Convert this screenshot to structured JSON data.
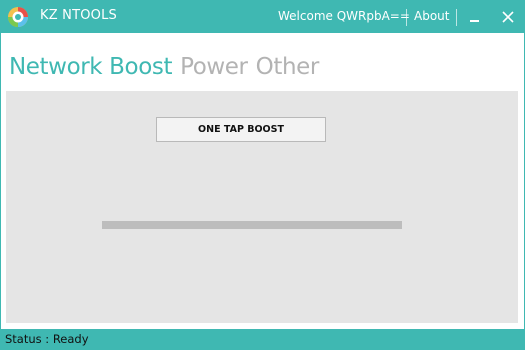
{
  "app": {
    "title": "KZ NTOOLS",
    "welcome": "Welcome QWRpbA==",
    "about_label": "About",
    "accent_color": "#3fb8b2"
  },
  "window_controls": {
    "minimize_icon": "minimize-icon",
    "close_icon": "close-icon"
  },
  "tabs": [
    {
      "label": "Network Boost",
      "active": true
    },
    {
      "label": "Power",
      "active": false
    },
    {
      "label": "Other",
      "active": false
    }
  ],
  "network_boost": {
    "button_label": "ONE TAP BOOST",
    "progress": 0
  },
  "status": {
    "text": "Status : Ready"
  }
}
